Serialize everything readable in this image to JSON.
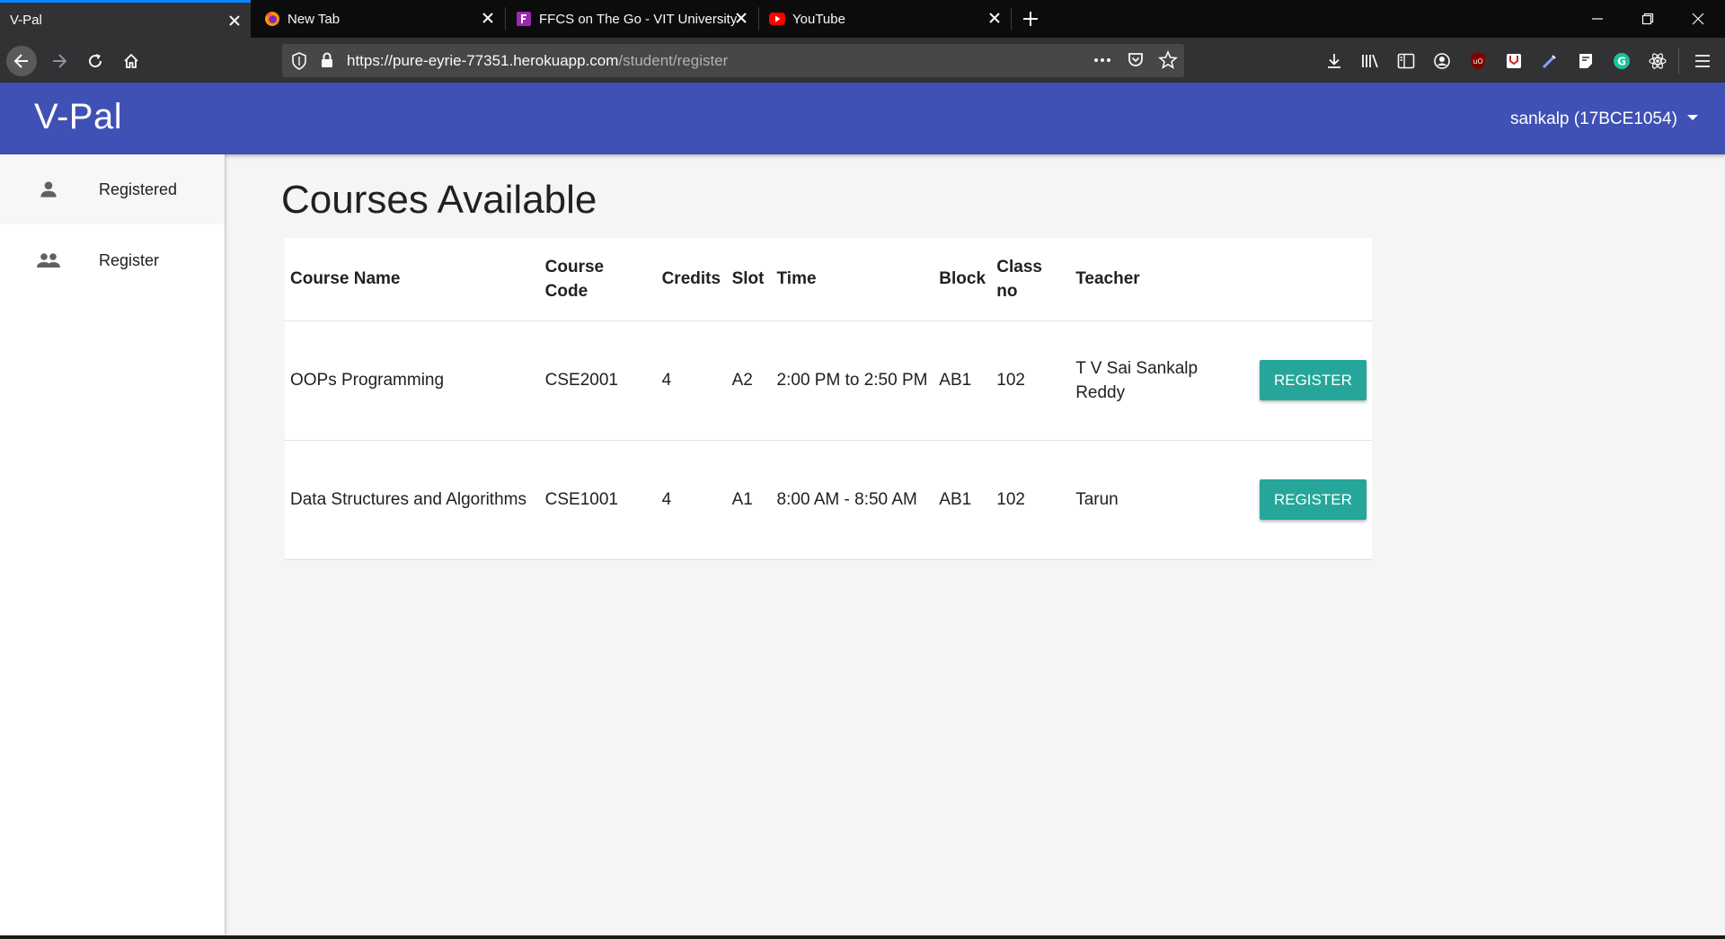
{
  "browser": {
    "tabs": [
      {
        "title": "V-Pal",
        "active": true,
        "favicon": "none"
      },
      {
        "title": "New Tab",
        "active": false,
        "favicon": "firefox-icon"
      },
      {
        "title": "FFCS on The Go - VIT University",
        "active": false,
        "favicon": "ffcs-icon"
      },
      {
        "title": "YouTube",
        "active": false,
        "favicon": "youtube-icon"
      }
    ],
    "url_host": "https://pure-eyrie-77351.herokuapp.com",
    "url_path": "/student/register",
    "accent_color": "#0a84ff"
  },
  "app": {
    "logo": "V-Pal",
    "user": "sankalp (17BCE1054)",
    "header_color": "#3f51b5"
  },
  "sidebar": {
    "items": [
      {
        "label": "Registered",
        "icon": "person-icon",
        "active": true
      },
      {
        "label": "Register",
        "icon": "people-icon",
        "active": false
      }
    ]
  },
  "main": {
    "title": "Courses Available",
    "table": {
      "columns": [
        "Course Name",
        "Course Code",
        "Credits",
        "Slot",
        "Time",
        "Block",
        "Class no",
        "Teacher",
        ""
      ],
      "rows": [
        {
          "name": "OOPs Programming",
          "code": "CSE2001",
          "credits": "4",
          "slot": "A2",
          "time": "2:00 PM to 2:50 PM",
          "block": "AB1",
          "class_no": "102",
          "teacher": "T V Sai Sankalp Reddy",
          "action": "REGISTER"
        },
        {
          "name": "Data Structures and Algorithms",
          "code": "CSE1001",
          "credits": "4",
          "slot": "A1",
          "time": "8:00 AM - 8:50 AM",
          "block": "AB1",
          "class_no": "102",
          "teacher": "Tarun",
          "action": "REGISTER"
        }
      ]
    },
    "button_color": "#26a69a"
  }
}
